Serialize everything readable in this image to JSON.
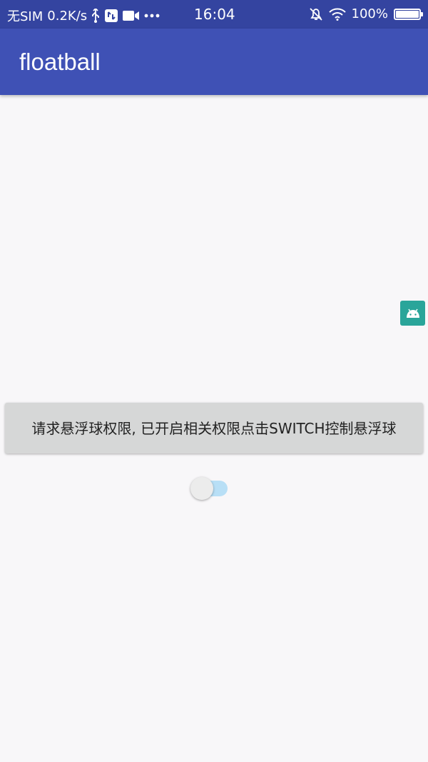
{
  "status_bar": {
    "carrier": "无SIM",
    "net_speed": "0.2K/s",
    "time": "16:04",
    "battery": "100%",
    "battery_level": 1.0,
    "icons": [
      "usb-icon",
      "sync-icon",
      "video-icon",
      "more-dots-icon",
      "bell-off-icon",
      "wifi-icon",
      "battery-icon"
    ]
  },
  "app_bar": {
    "title": "floatball",
    "color": "#3f51b5"
  },
  "float_ball": {
    "icon": "android-icon",
    "color": "#2aa59a"
  },
  "main": {
    "request_button_label": "请求悬浮球权限, 已开启相关权限点击SWITCH控制悬浮球",
    "switch": {
      "checked": false
    }
  }
}
